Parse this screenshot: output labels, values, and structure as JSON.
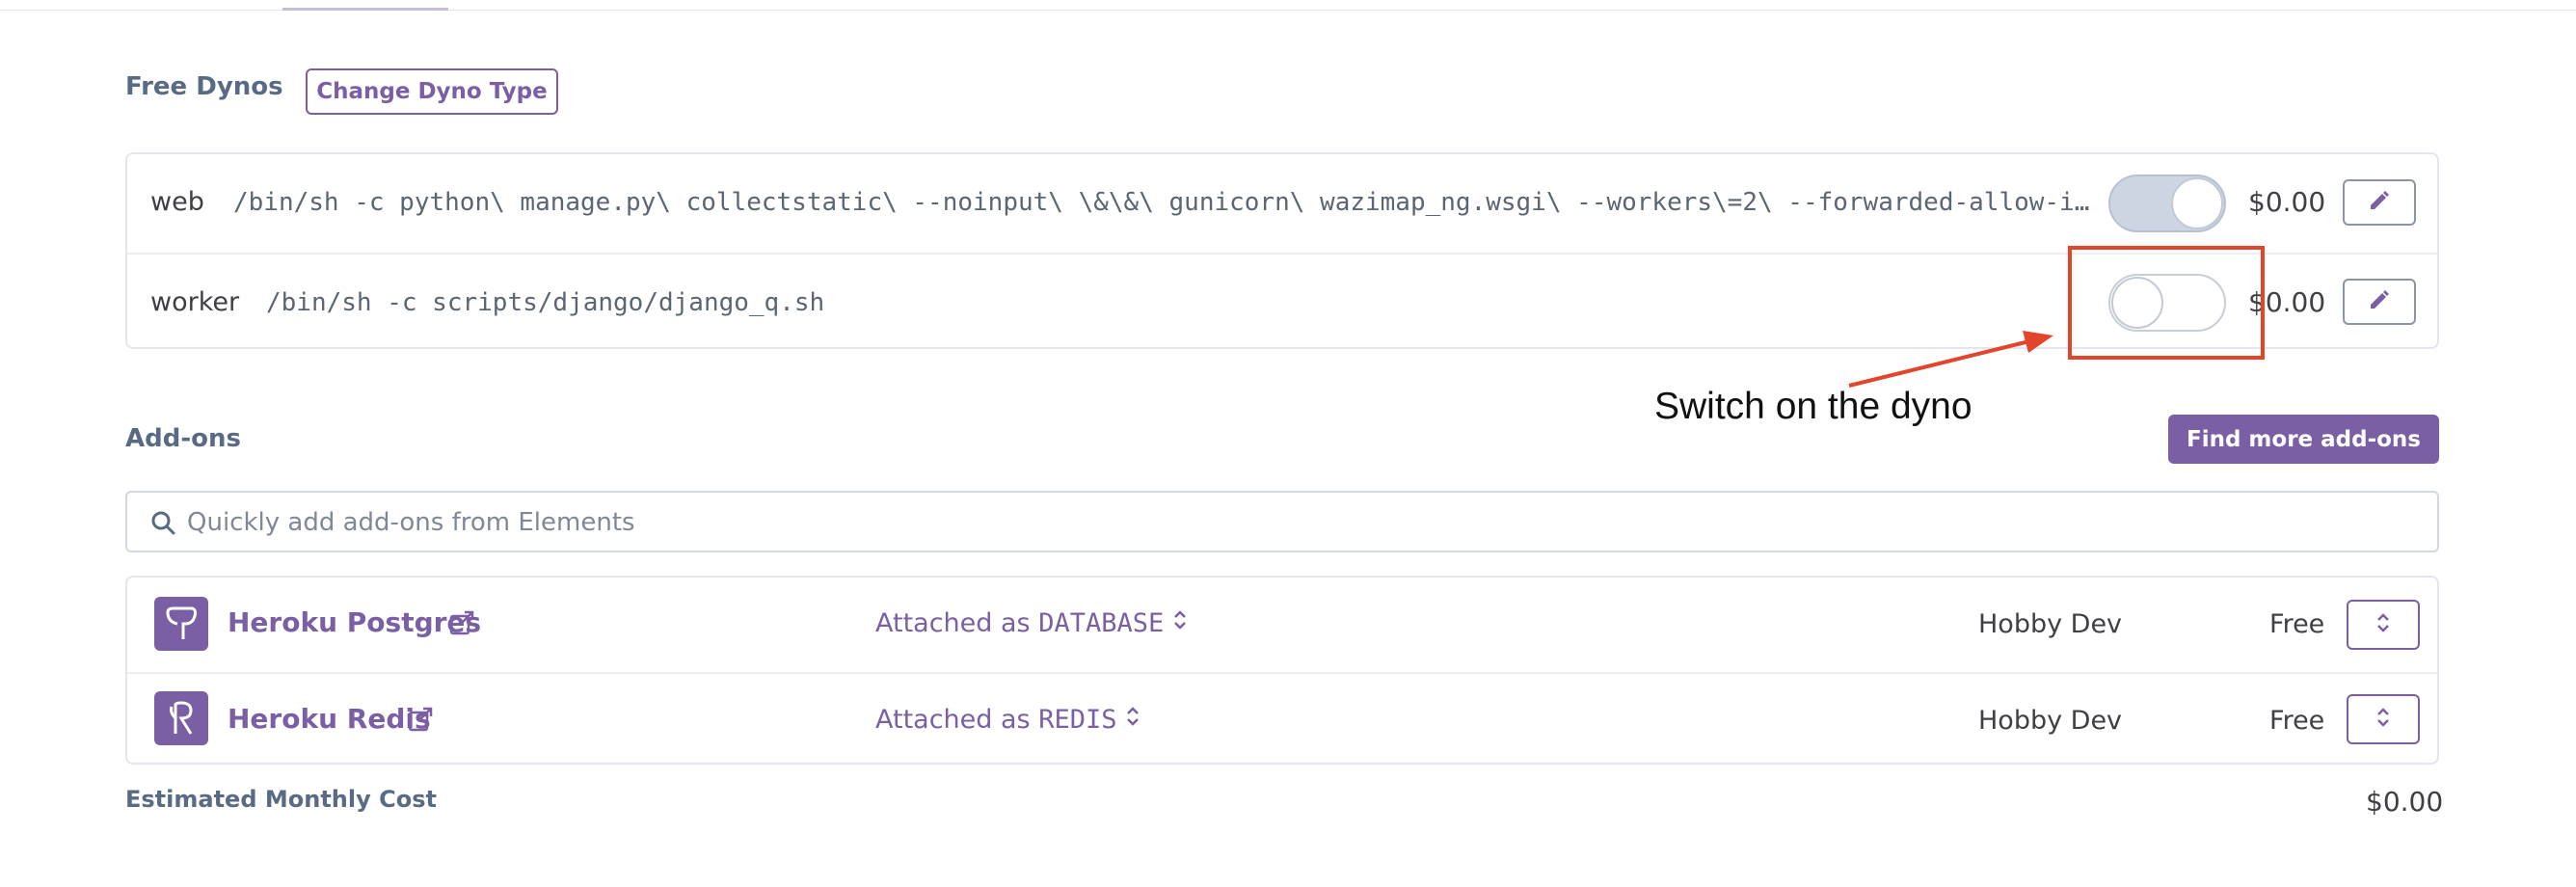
{
  "dynos": {
    "section_title": "Free Dynos",
    "change_type_label": "Change Dyno Type",
    "items": [
      {
        "name": "web",
        "command": "/bin/sh -c python\\ manage.py\\ collectstatic\\ --noinput\\ \\&\\&\\ gunicorn\\ wazimap_ng.wsgi\\ --workers\\=2\\ --forwarded-allow-ips\\=*",
        "enabled": true,
        "price": "$0.00"
      },
      {
        "name": "worker",
        "command": "/bin/sh -c scripts/django/django_q.sh",
        "enabled": false,
        "price": "$0.00"
      }
    ]
  },
  "addons": {
    "section_title": "Add-ons",
    "find_more_label": "Find more add-ons",
    "search_placeholder": "Quickly add add-ons from Elements",
    "items": [
      {
        "name": "Heroku Postgres",
        "attached_prefix": "Attached as",
        "attached_as": "DATABASE",
        "plan": "Hobby Dev",
        "price": "Free"
      },
      {
        "name": "Heroku Redis",
        "attached_prefix": "Attached as",
        "attached_as": "REDIS",
        "plan": "Hobby Dev",
        "price": "Free"
      }
    ]
  },
  "summary": {
    "estimated_label": "Estimated Monthly Cost",
    "estimated_value": "$0.00"
  },
  "annotation": {
    "text": "Switch on the dyno",
    "color": "#e2452b"
  },
  "colors": {
    "accent": "#7a5fa4",
    "heading": "#596b84"
  }
}
